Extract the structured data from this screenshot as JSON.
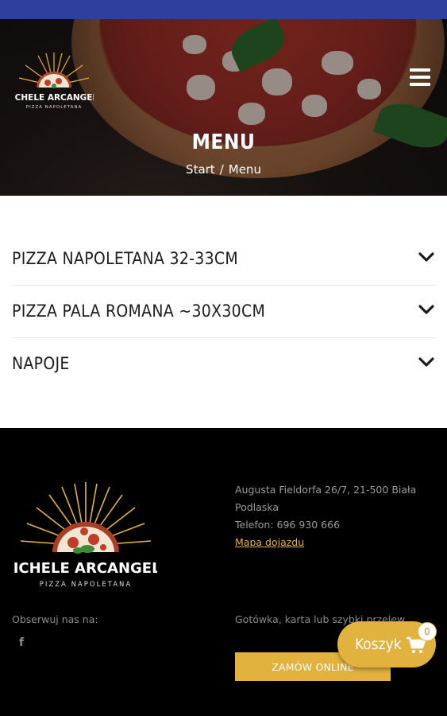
{
  "header": {
    "title": "MENU",
    "breadcrumb": [
      {
        "label": "Start"
      },
      {
        "label": "Menu"
      }
    ],
    "breadcrumb_separator": "/"
  },
  "brand": {
    "name": "MICHELE ARCANGELO",
    "tagline": "PIZZA NAPOLETANA"
  },
  "menu": {
    "categories": [
      {
        "label": "PIZZA NAPOLETANA 32-33CM"
      },
      {
        "label": "PIZZA PALA ROMANA ~30X30CM"
      },
      {
        "label": "NAPOJE"
      }
    ]
  },
  "footer": {
    "address_line1": "Augusta Fieldorfa 26/7, 21-500 Biała",
    "address_line2": "Podlaska",
    "phone": "Telefon: 696 930 666",
    "map_link": "Mapa dojazdu",
    "follow_label": "Obserwuj nas na:",
    "facebook_glyph": "f",
    "payment_text": "Gotówka, karta lub szybki przelew",
    "order_button": "ZAMÓW ONLINE"
  },
  "cart": {
    "label": "Koszyk",
    "count": "0"
  },
  "colors": {
    "accent": "#e2b23f",
    "status_bar": "#2f3f9e",
    "footer_bg": "#000000"
  },
  "icons": [
    "menu-icon",
    "chevron-down-icon",
    "facebook-icon",
    "cart-icon"
  ]
}
